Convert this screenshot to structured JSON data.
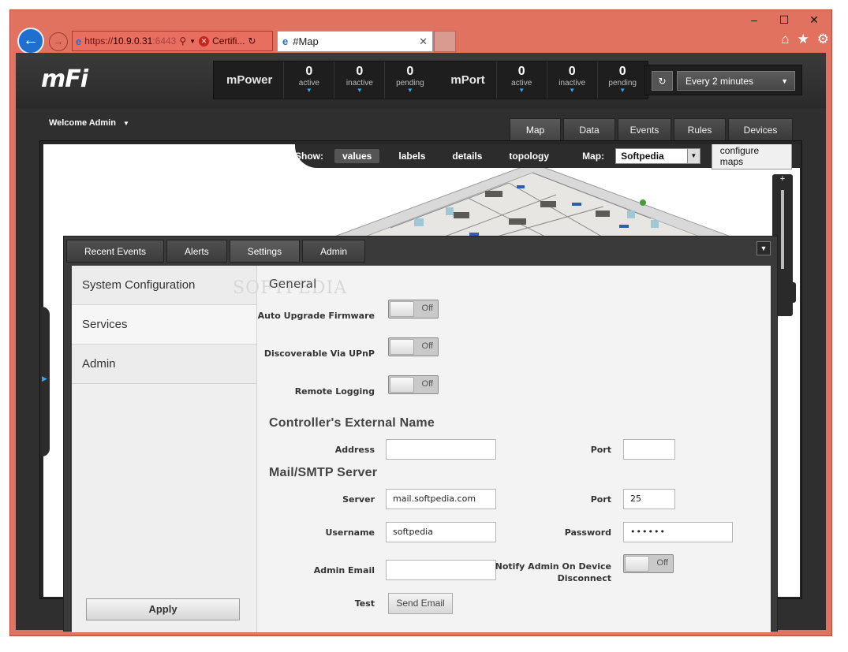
{
  "browser": {
    "window_buttons": [
      "–",
      "☐",
      "✕"
    ],
    "address_url_prefix": "https://",
    "address_url_host": "10.9.0.31",
    "address_url_port": ":6443",
    "cert_error_label": "Certifi...",
    "tab_title": "#Map",
    "toolbar_icons": [
      "home-icon",
      "star-icon",
      "gear-icon"
    ]
  },
  "header": {
    "logo": "mFi",
    "mpower": {
      "title": "mPower",
      "stats": [
        {
          "value": "0",
          "label": "active"
        },
        {
          "value": "0",
          "label": "inactive"
        },
        {
          "value": "0",
          "label": "pending"
        }
      ]
    },
    "mport": {
      "title": "mPort",
      "stats": [
        {
          "value": "0",
          "label": "active"
        },
        {
          "value": "0",
          "label": "inactive"
        },
        {
          "value": "0",
          "label": "pending"
        }
      ]
    },
    "refresh_interval": "Every 2 minutes"
  },
  "nav": {
    "welcome": "Welcome Admin",
    "tabs": [
      "Map",
      "Data",
      "Events",
      "Rules",
      "Devices"
    ],
    "active_tab": "Map"
  },
  "map": {
    "show_label": "Show:",
    "show_options": [
      "values",
      "labels",
      "details",
      "topology"
    ],
    "active_show": "values",
    "map_label": "Map:",
    "map_selected": "Softpedia",
    "configure_maps": "configure maps",
    "zoom_plus": "+"
  },
  "panel": {
    "tabs": [
      "Recent Events",
      "Alerts",
      "Settings",
      "Admin"
    ],
    "active_tab": "Settings",
    "nav_items": [
      "System Configuration",
      "Services",
      "Admin"
    ],
    "active_nav": "Services",
    "apply": "Apply",
    "watermark": "SOFTPEDIA",
    "general": {
      "title": "General",
      "auto_upgrade_label": "Auto Upgrade Firmware",
      "auto_upgrade_state": "Off",
      "upnp_label": "Discoverable Via UPnP",
      "upnp_state": "Off",
      "remote_logging_label": "Remote Logging",
      "remote_logging_state": "Off"
    },
    "external": {
      "title": "Controller's External Name",
      "address_label": "Address",
      "address_value": "",
      "port_label": "Port",
      "port_value": ""
    },
    "smtp": {
      "title": "Mail/SMTP Server",
      "server_label": "Server",
      "server_value": "mail.softpedia.com",
      "port_label": "Port",
      "port_value": "25",
      "username_label": "Username",
      "username_value": "softpedia",
      "password_label": "Password",
      "password_value": "••••••",
      "admin_email_label": "Admin Email",
      "admin_email_value": "",
      "notify_label_1": "Notify Admin On Device",
      "notify_label_2": "Disconnect",
      "notify_state": "Off",
      "test_label": "Test",
      "send_email": "Send Email"
    }
  }
}
